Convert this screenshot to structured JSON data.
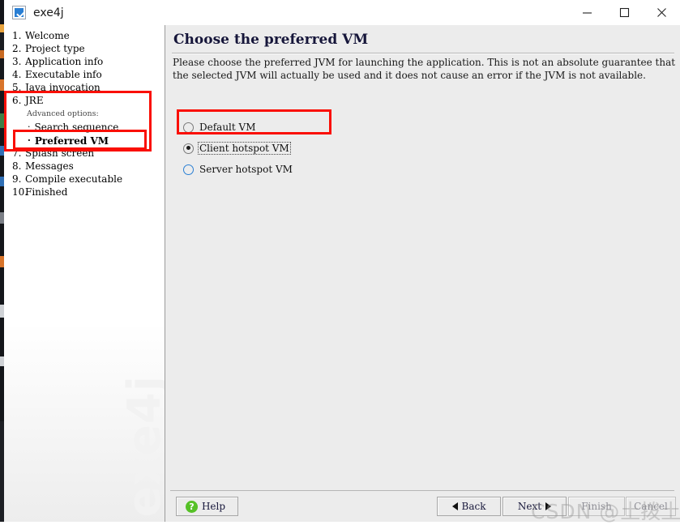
{
  "window": {
    "title": "exe4j",
    "icon": "exe4j-app-icon",
    "controls": [
      {
        "name": "minimize",
        "glyph": "minimize-icon"
      },
      {
        "name": "maximize",
        "glyph": "maximize-icon"
      },
      {
        "name": "close",
        "glyph": "close-icon"
      }
    ]
  },
  "sidebar": {
    "watermark": "exe4j",
    "steps": [
      {
        "num": "1.",
        "label": "Welcome",
        "selected": false
      },
      {
        "num": "2.",
        "label": "Project type",
        "selected": false
      },
      {
        "num": "3.",
        "label": "Application info",
        "selected": false
      },
      {
        "num": "4.",
        "label": "Executable info",
        "selected": false
      },
      {
        "num": "5.",
        "label": "Java invocation",
        "selected": false
      },
      {
        "num": "6.",
        "label": "JRE",
        "selected": false
      },
      {
        "num": "7.",
        "label": "Splash screen",
        "selected": false
      },
      {
        "num": "8.",
        "label": "Messages",
        "selected": false
      },
      {
        "num": "9.",
        "label": "Compile executable",
        "selected": false
      },
      {
        "num": "10.",
        "label": "Finished",
        "selected": false
      }
    ],
    "advanced_options_label": "Advanced options:",
    "sub_items": [
      {
        "bullet": "·",
        "label": "Search sequence",
        "selected": false
      },
      {
        "bullet": "·",
        "label": "Preferred VM",
        "selected": true
      }
    ]
  },
  "panel": {
    "title": "Choose the preferred VM",
    "description": "Please choose the preferred JVM for launching the application. This is not an absolute guarantee that the selected JVM will actually be used and it does not cause an error if the JVM is not available.",
    "radio_options": [
      {
        "label": "Default VM",
        "checked": false,
        "focused": false,
        "hover": false
      },
      {
        "label": "Client hotspot VM",
        "checked": true,
        "focused": true,
        "hover": false
      },
      {
        "label": "Server hotspot VM",
        "checked": false,
        "focused": false,
        "hover": true
      }
    ]
  },
  "buttons": {
    "help": "Help",
    "back": "Back",
    "next": "Next",
    "finish": "Finish",
    "cancel": "Cancel"
  },
  "annotations": {
    "color": "#fa0f04",
    "boxes": [
      {
        "name": "jre-advanced-options-highlight"
      },
      {
        "name": "preferred-vm-highlight"
      },
      {
        "name": "client-hotspot-vm-highlight"
      }
    ]
  },
  "watermark": {
    "csdn": "CSDN @",
    "csdn_cn": "土拨土拨鼠"
  }
}
